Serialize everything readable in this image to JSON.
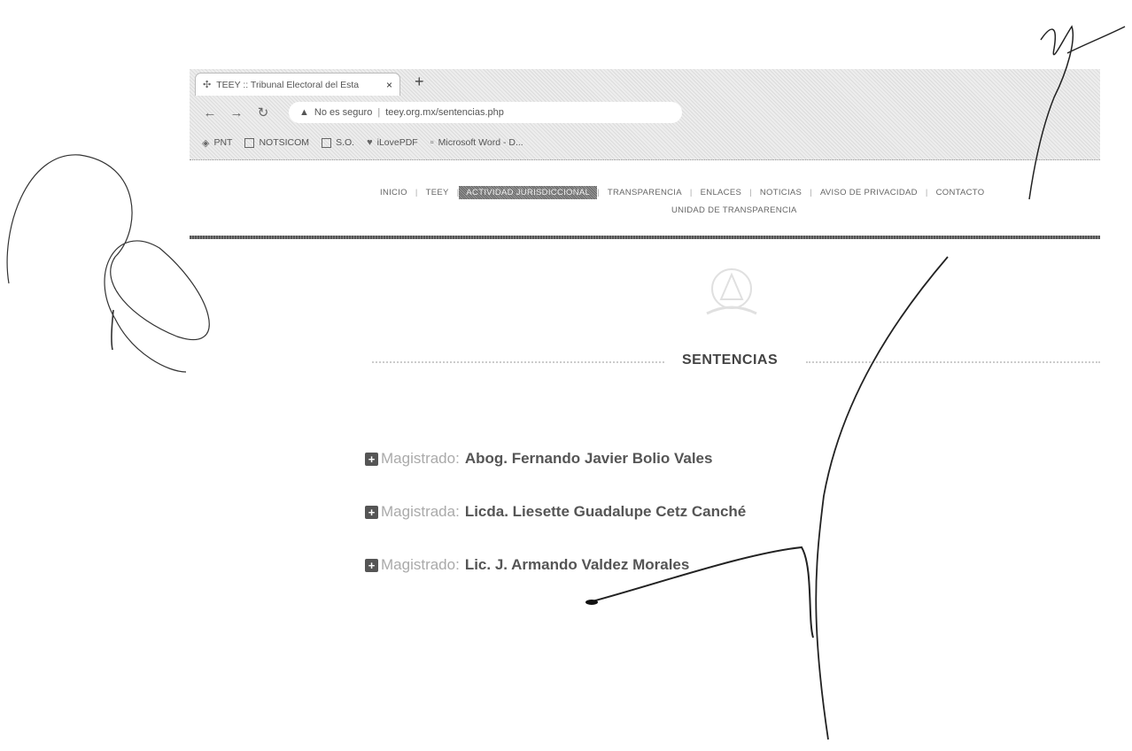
{
  "browser": {
    "tab_title": "TEEY :: Tribunal Electoral del Esta",
    "tab_close": "×",
    "new_tab": "+",
    "address_security": "No es seguro",
    "address_url": "teey.org.mx/sentencias.php",
    "bookmarks": [
      "PNT",
      "NOTSICOM",
      "S.O.",
      "iLovePDF",
      "Microsoft Word - D..."
    ]
  },
  "site_nav": {
    "items": [
      "INICIO",
      "TEEY",
      "ACTIVIDAD JURISDICCIONAL",
      "TRANSPARENCIA",
      "ENLACES",
      "NOTICIAS",
      "AVISO DE PRIVACIDAD",
      "CONTACTO"
    ],
    "active": "ACTIVIDAD JURISDICCIONAL",
    "second_row": "UNIDAD DE TRANSPARENCIA"
  },
  "section": {
    "heading": "SENTENCIAS"
  },
  "magistrates": [
    {
      "role": "Magistrado:",
      "name": "Abog. Fernando Javier Bolio Vales"
    },
    {
      "role": "Magistrada:",
      "name": "Licda. Liesette Guadalupe Cetz Canché"
    },
    {
      "role": "Magistrado:",
      "name": "Lic. J. Armando Valdez Morales"
    }
  ]
}
